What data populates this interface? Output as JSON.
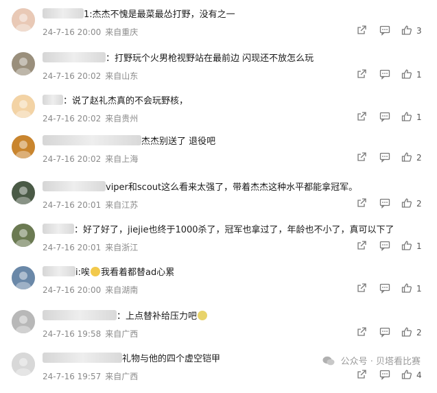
{
  "comments": [
    {
      "pre_blur": 60,
      "mid": "1:",
      "post_blur": 0,
      "text": "杰杰不愧是最菜最怂打野，没有之一",
      "date": "24-7-16 20:00",
      "loc": "来自重庆",
      "likes": "3",
      "avatar": "#e9c9b6"
    },
    {
      "pre_blur": 92,
      "mid": "",
      "post_blur": 0,
      "text": "：打野玩个火男枪视野站在最前边 闪现还不放怎么玩",
      "date": "24-7-16 20:02",
      "loc": "来自山东",
      "likes": "1",
      "avatar": "#9a8f7c"
    },
    {
      "pre_blur": 30,
      "mid": "",
      "post_blur": 0,
      "text": "：说了赵礼杰真的不会玩野核，",
      "date": "24-7-16 20:02",
      "loc": "来自贵州",
      "likes": "1",
      "avatar": "#f3d3a5"
    },
    {
      "pre_blur": 144,
      "mid": "",
      "post_blur": 0,
      "text": "杰杰别送了 退役吧",
      "date": "24-7-16 20:02",
      "loc": "来自上海",
      "likes": "2",
      "avatar": "#c9852e"
    },
    {
      "pre_blur": 92,
      "mid": "",
      "post_blur": 0,
      "text": "viper和scout这么看来太强了，带着杰杰这种水平都能拿冠军。",
      "date": "24-7-16 20:01",
      "loc": "来自江苏",
      "likes": "2",
      "avatar": "#4a5a46"
    },
    {
      "pre_blur": 46,
      "mid": "",
      "post_blur": 0,
      "text": "：好了好了，jiejie也终于1000杀了，冠军也拿过了，年龄也不小了，真可以下了",
      "date": "24-7-16 20:01",
      "loc": "来自浙江",
      "likes": "1",
      "avatar": "#6b7a52"
    },
    {
      "pre_blur": 48,
      "mid": "i:唉",
      "post_blur": 0,
      "text": "我看着都替ad心累",
      "date": "24-7-16 20:00",
      "loc": "来自湖南",
      "likes": "1",
      "avatar": "#6a88a8"
    },
    {
      "pre_blur": 108,
      "mid": "",
      "post_blur": 0,
      "text": "：上点替补给压力吧",
      "date": "24-7-16 19:58",
      "loc": "来自广西",
      "likes": "2",
      "avatar": "#b8b8b8"
    },
    {
      "pre_blur": 116,
      "mid": "",
      "post_blur": 0,
      "text": "礼物与他的四个虚空铠甲",
      "date": "24-7-16 19:57",
      "loc": "来自广西",
      "likes": "4",
      "avatar": "#d8d8d8"
    }
  ],
  "watermark": "公众号 · 贝塔看比赛"
}
